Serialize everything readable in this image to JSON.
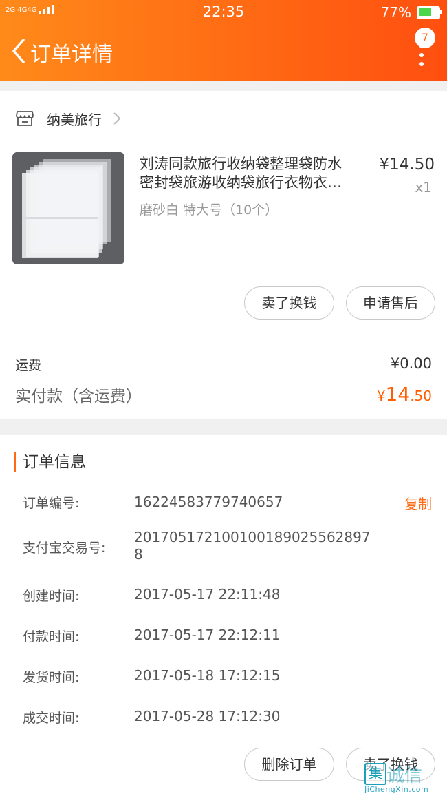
{
  "status_bar": {
    "signal_text": "2G 4G4G",
    "time": "22:35",
    "battery_percent": "77%",
    "battery_level": 0.77
  },
  "header": {
    "title": "订单详情",
    "notification_count": "7",
    "gradient_start": "#ff8a1a",
    "gradient_end": "#ff4f10"
  },
  "shop": {
    "name": "纳美旅行",
    "icon": "store-icon"
  },
  "product": {
    "title_line1": "刘涛同款旅行收纳袋整理袋防水",
    "title_line2": "密封袋旅游收纳袋旅行衣物衣…",
    "price": "¥14.50",
    "quantity": "x1",
    "sku": "磨砂白 特大号（10个）"
  },
  "item_actions": {
    "sell_label": "卖了换钱",
    "after_sale_label": "申请售后"
  },
  "summary": {
    "shipping_label": "运费",
    "shipping_value": "¥0.00",
    "total_label": "实付款（含运费）",
    "total_currency": "¥",
    "total_integer": "14",
    "total_decimal": ".50"
  },
  "order_info": {
    "section_title": "订单信息",
    "copy_label": "复制",
    "rows": [
      {
        "label": "订单编号:",
        "value": "16224583779740657"
      },
      {
        "label": "支付宝交易号:",
        "value_line1": "20170517210010018902556289​7",
        "value_line2": "8"
      },
      {
        "label": "创建时间:",
        "value": "2017-05-17 22:11:48"
      },
      {
        "label": "付款时间:",
        "value": "2017-05-17 22:12:11"
      },
      {
        "label": "发货时间:",
        "value": "2017-05-18 17:12:15"
      },
      {
        "label": "成交时间:",
        "value": "2017-05-28 17:12:30"
      }
    ]
  },
  "bottom_actions": {
    "delete_label": "删除订单",
    "sell_label": "卖了换钱"
  },
  "watermark": {
    "box_char": "集",
    "cn_text": "诚信",
    "en_text": "JiChengXin.com"
  },
  "colors": {
    "accent": "#ff6a14",
    "price_orange": "#ff5d00",
    "battery_green": "#4cd64c"
  }
}
